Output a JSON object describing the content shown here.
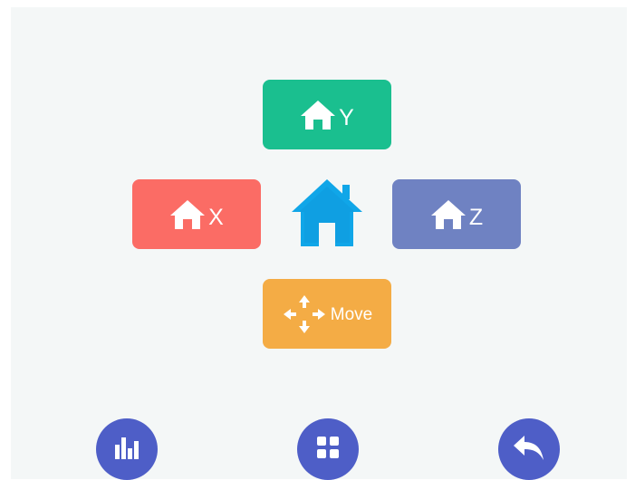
{
  "home_buttons": {
    "y": {
      "label": "Y",
      "color": "#1abf8f",
      "icon": "home-icon"
    },
    "x": {
      "label": "X",
      "color": "#fb6c65",
      "icon": "home-icon"
    },
    "z": {
      "label": "Z",
      "color": "#6f82c2",
      "icon": "home-icon"
    },
    "all": {
      "icon": "home-icon",
      "color": "#10a6e8"
    }
  },
  "move_button": {
    "label": "Move",
    "color": "#f4ac45",
    "icon": "move-arrows-icon"
  },
  "bottom_bar": {
    "color": "#4e5ec7",
    "items": [
      {
        "name": "stats",
        "icon": "bar-chart-icon"
      },
      {
        "name": "menu",
        "icon": "grid-icon"
      },
      {
        "name": "back",
        "icon": "back-arrow-icon"
      }
    ]
  }
}
